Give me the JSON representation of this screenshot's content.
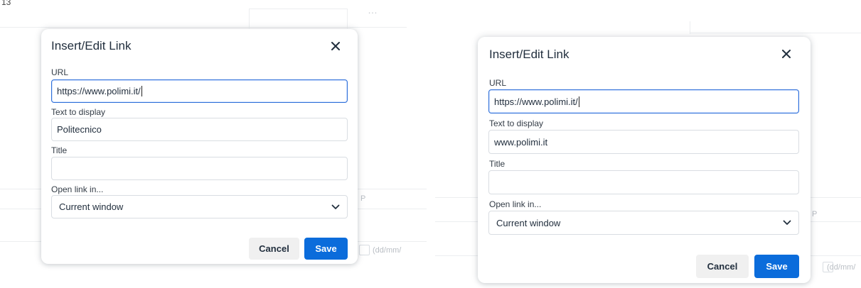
{
  "corner_text": "13",
  "background": {
    "dots": "…",
    "p_letter": "P",
    "date_hint": "(dd/mm/"
  },
  "dialogs": [
    {
      "title": "Insert/Edit Link",
      "url_label": "URL",
      "url_value": "https://www.polimi.it/",
      "text_label": "Text to display",
      "text_value": "Politecnico",
      "title_label": "Title",
      "title_value": "",
      "open_label": "Open link in...",
      "open_value": "Current window",
      "cancel_label": "Cancel",
      "save_label": "Save"
    },
    {
      "title": "Insert/Edit Link",
      "url_label": "URL",
      "url_value": "https://www.polimi.it/",
      "text_label": "Text to display",
      "text_value": "www.polimi.it",
      "title_label": "Title",
      "title_value": "",
      "open_label": "Open link in...",
      "open_value": "Current window",
      "cancel_label": "Cancel",
      "save_label": "Save"
    }
  ],
  "colors": {
    "primary": "#0b6cdb",
    "focus_border": "#2f6fd8",
    "cancel_bg": "#f0f0f0"
  }
}
